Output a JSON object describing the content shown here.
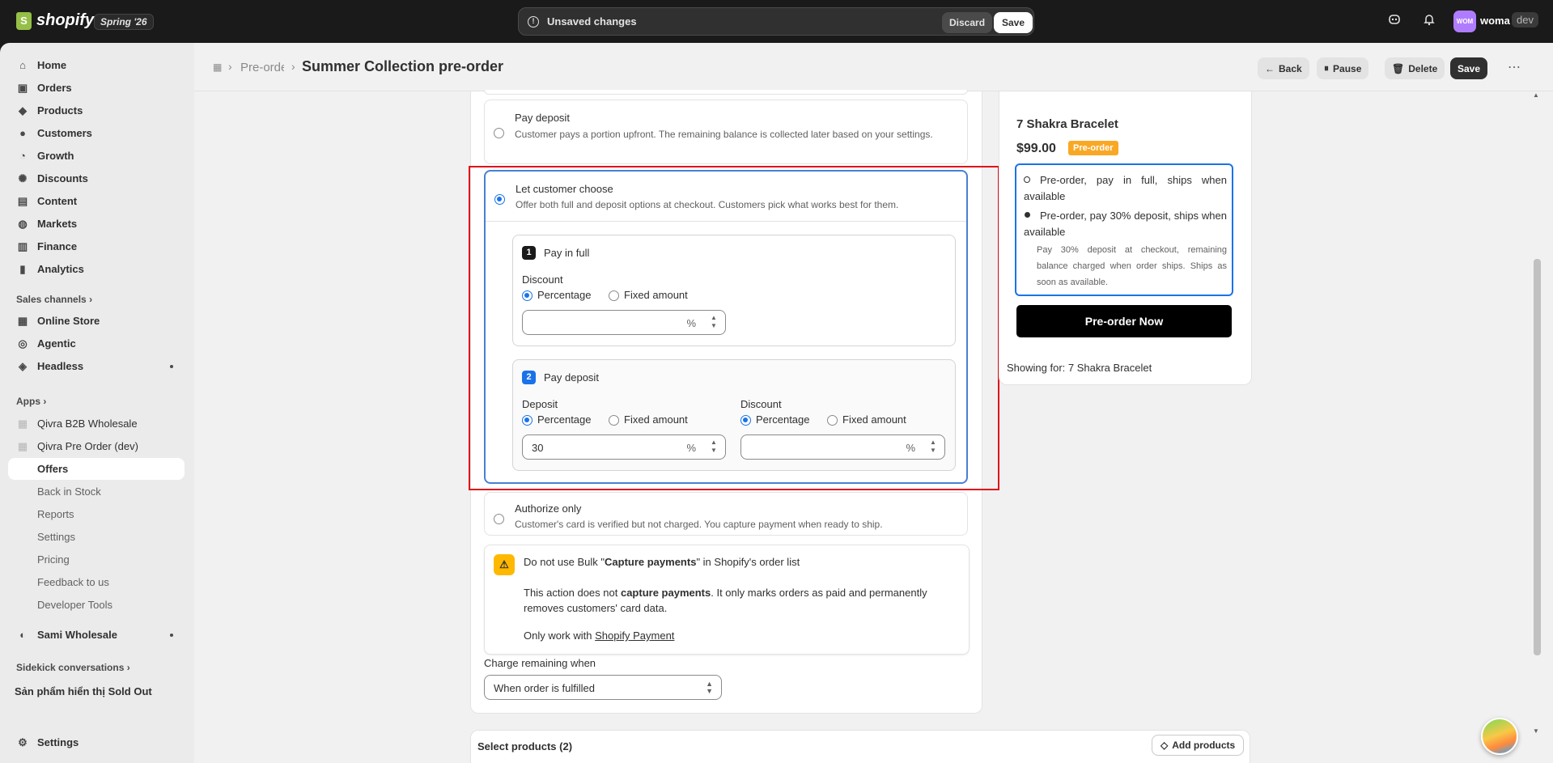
{
  "topbar": {
    "logo_text": "shopify",
    "edition_badge": "Spring '26",
    "unsaved_text": "Unsaved changes",
    "discard_label": "Discard",
    "save_label": "Save",
    "avatar_initials": "WOM",
    "store_name": "woma",
    "dev_tag": "dev"
  },
  "sidebar": {
    "main_items": [
      {
        "label": "Home",
        "icon": "home-icon"
      },
      {
        "label": "Orders",
        "icon": "orders-icon"
      },
      {
        "label": "Products",
        "icon": "tag-icon"
      },
      {
        "label": "Customers",
        "icon": "person-icon"
      },
      {
        "label": "Growth",
        "icon": "growth-icon"
      },
      {
        "label": "Discounts",
        "icon": "discount-icon"
      },
      {
        "label": "Content",
        "icon": "content-icon"
      },
      {
        "label": "Markets",
        "icon": "globe-icon"
      },
      {
        "label": "Finance",
        "icon": "bank-icon"
      },
      {
        "label": "Analytics",
        "icon": "chart-icon"
      }
    ],
    "sales_channels_label": "Sales channels",
    "channels": [
      {
        "label": "Online Store",
        "icon": "store-icon"
      },
      {
        "label": "Agentic",
        "icon": "agentic-icon"
      },
      {
        "label": "Headless",
        "icon": "headless-icon"
      }
    ],
    "apps_label": "Apps",
    "apps": [
      {
        "label": "Qivra B2B Wholesale"
      },
      {
        "label": "Qivra Pre Order (dev)"
      }
    ],
    "app_subitems": [
      "Offers",
      "Back in Stock",
      "Reports",
      "Settings",
      "Pricing",
      "Feedback to us",
      "Developer Tools"
    ],
    "sami_label": "Sami Wholesale",
    "sidekick_label": "Sidekick conversations",
    "sold_out_label": "Sản phẩm hiển thị Sold Out",
    "settings_label": "Settings"
  },
  "header": {
    "breadcrumb": "Pre-order",
    "title": "Summer Collection pre-order",
    "back_label": "Back",
    "pause_label": "Pause",
    "delete_label": "Delete",
    "save_label": "Save",
    "more_label": "⋯"
  },
  "payment": {
    "pay_deposit_title": "Pay deposit",
    "pay_deposit_desc": "Customer pays a portion upfront. The remaining balance is collected later based on your settings.",
    "choose_title": "Let customer choose",
    "choose_desc": "Offer both full and deposit options at checkout. Customers pick what works best for them.",
    "full": {
      "number": "1",
      "title": "Pay in full",
      "discount_label": "Discount",
      "percentage_label": "Percentage",
      "fixed_label": "Fixed amount",
      "value": "",
      "unit": "%"
    },
    "deposit": {
      "number": "2",
      "title": "Pay deposit",
      "deposit_label": "Deposit",
      "discount_label": "Discount",
      "percentage_label": "Percentage",
      "fixed_label": "Fixed amount",
      "deposit_value": "30",
      "discount_value": "",
      "unit": "%"
    },
    "authorize_title": "Authorize only",
    "authorize_desc": "Customer's card is verified but not charged. You capture payment when ready to ship.",
    "warning": {
      "line1_pre": "Do not use Bulk \"",
      "line1_bold": "Capture payments",
      "line1_post": "\" in Shopify's order list",
      "line2_pre": "This action does not ",
      "line2_bold": "capture payments",
      "line2_post": ". It only marks orders as paid and permanently removes customers' card data.",
      "line3_pre": "Only work with ",
      "line3_link": "Shopify Payment"
    },
    "charge_label": "Charge remaining when",
    "charge_value": "When order is fulfilled"
  },
  "preview": {
    "product_name": "7 Shakra Bracelet",
    "price": "$99.00",
    "badge": "Pre-order",
    "option1": "Pre-order, pay in full, ships when available",
    "option2": "Pre-order, pay 30% deposit, ships when available",
    "option2_note": "Pay 30% deposit at checkout, remaining balance charged when order ships. Ships as soon as available.",
    "button_label": "Pre-order Now",
    "showing_for": "Showing for: 7 Shakra Bracelet"
  },
  "products": {
    "title": "Select products (2)",
    "add_label": "Add products"
  },
  "colors": {
    "accent": "#1a73e8",
    "highlight": "#e0121b",
    "badge": "#f9a825",
    "warning": "#ffb800"
  }
}
